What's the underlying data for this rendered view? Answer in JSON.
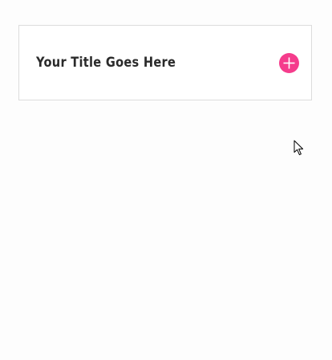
{
  "accordion": {
    "title": "Your Title Goes Here",
    "toggle_icon": "plus-circle-icon",
    "accent_color": "#f53c8c",
    "border_color": "#dcdcdc",
    "expanded": false
  },
  "cursor": {
    "icon": "mouse-pointer-icon"
  }
}
